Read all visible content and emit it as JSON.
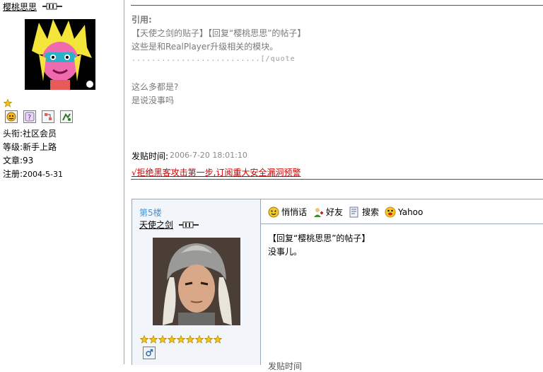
{
  "user1": {
    "name": "樱桃思思",
    "title_label": "头衔:",
    "title_value": "社区会员",
    "level_label": "等级:",
    "level_value": "新手上路",
    "posts_label": "文章:",
    "posts_value": "93",
    "reg_label": "注册:",
    "reg_value": "2004-5-31"
  },
  "post1": {
    "quote_label": "引用:",
    "quote_line1": "【天使之剑的贴子】【回复“樱桃思思”的帖子】",
    "quote_line2": "这些是和RealPlayer升级相关的模块。",
    "quote_dots": "..........................[/quote",
    "body_line1": "这么多都是?",
    "body_line2": "是说没事吗",
    "posttime_label": "发贴时间:",
    "posttime_value": "2006-7-20 18:01:10",
    "ad_link": "√拒绝黑客攻击第一步,订阅重大安全漏洞预警"
  },
  "post2": {
    "floor": "第5楼",
    "user_name": "天使之剑",
    "actions": [
      "悄悄话",
      "好友",
      "搜索",
      "Yahoo"
    ],
    "reply_title": "【回复“樱桃思思”的帖子】",
    "reply_body": "没事儿。",
    "bottom_partial": "发贴时间"
  },
  "icons": {
    "user_icon": "plug-icon",
    "star": "star-icon",
    "gender": "male-icon"
  },
  "colors": {
    "link_red": "#cc0000",
    "floor_blue": "#4a90d0",
    "meta_grey": "#7a7a7a",
    "panel_bg": "#f2f6fa"
  }
}
